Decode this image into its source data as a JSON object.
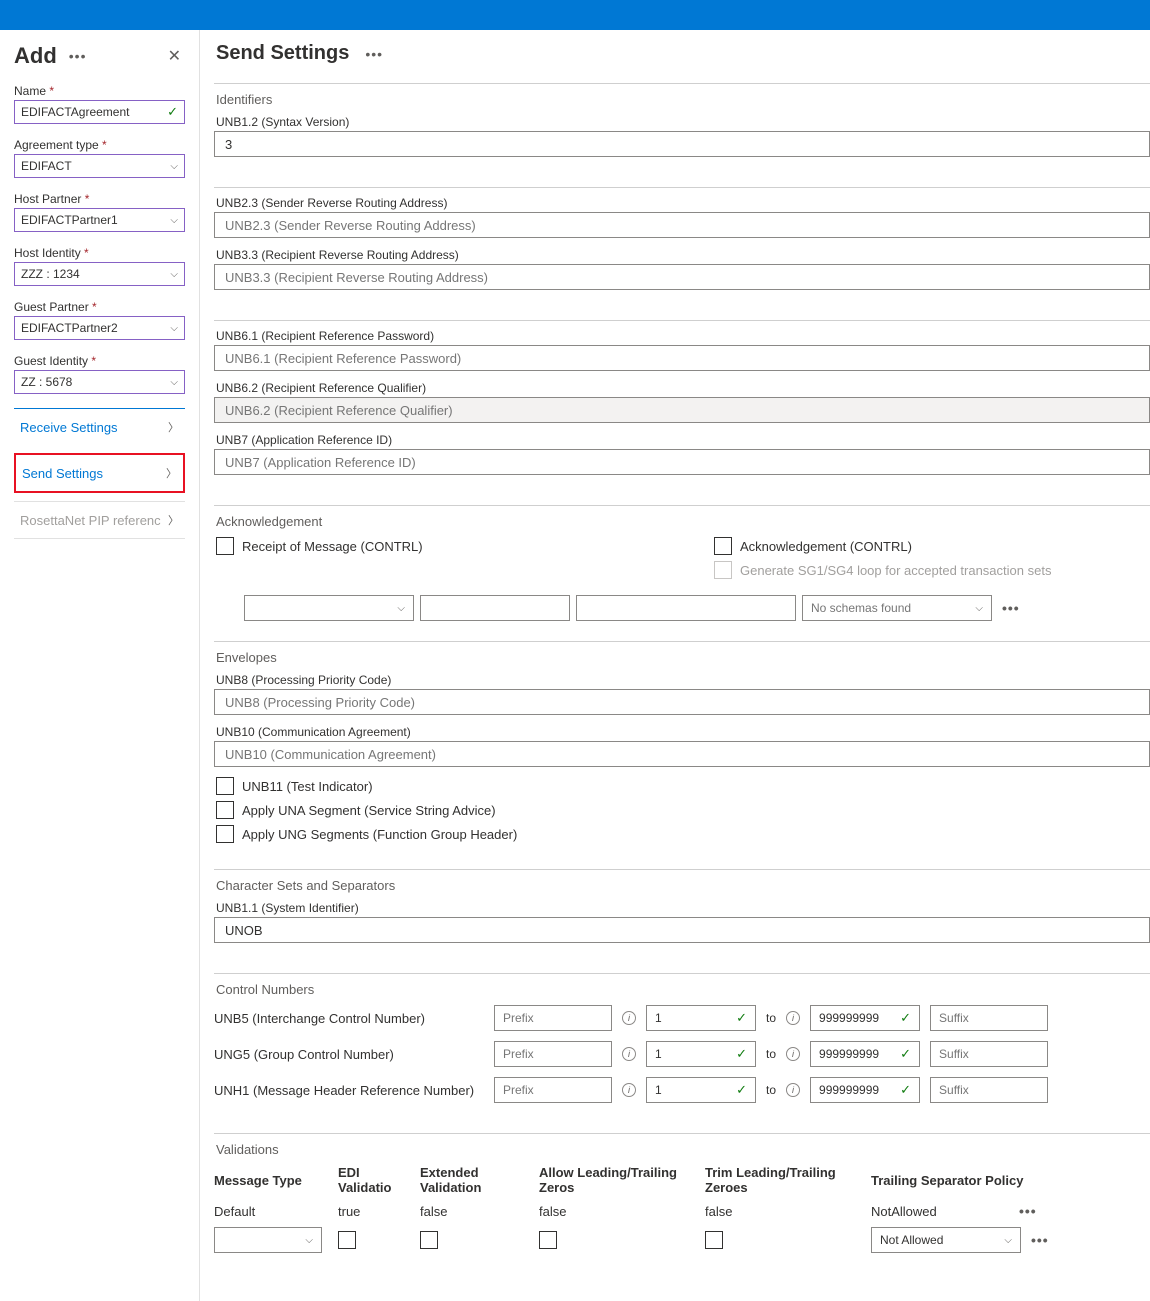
{
  "sidebar": {
    "title": "Add",
    "fields": {
      "name": {
        "label": "Name",
        "value": "EDIFACTAgreement"
      },
      "agreementType": {
        "label": "Agreement type",
        "value": "EDIFACT"
      },
      "hostPartner": {
        "label": "Host Partner",
        "value": "EDIFACTPartner1"
      },
      "hostIdentity": {
        "label": "Host Identity",
        "value": "ZZZ : 1234"
      },
      "guestPartner": {
        "label": "Guest Partner",
        "value": "EDIFACTPartner2"
      },
      "guestIdentity": {
        "label": "Guest Identity",
        "value": "ZZ : 5678"
      }
    },
    "nav": {
      "receive": "Receive Settings",
      "send": "Send Settings",
      "rosetta": "RosettaNet PIP referenc"
    }
  },
  "main": {
    "title": "Send Settings",
    "identifiers": {
      "section": "Identifiers",
      "unb12_label": "UNB1.2 (Syntax Version)",
      "unb12_value": "3",
      "unb23_label": "UNB2.3 (Sender Reverse Routing Address)",
      "unb23_placeholder": "UNB2.3 (Sender Reverse Routing Address)",
      "unb33_label": "UNB3.3 (Recipient Reverse Routing Address)",
      "unb33_placeholder": "UNB3.3 (Recipient Reverse Routing Address)",
      "unb61_label": "UNB6.1 (Recipient Reference Password)",
      "unb61_placeholder": "UNB6.1 (Recipient Reference Password)",
      "unb62_label": "UNB6.2 (Recipient Reference Qualifier)",
      "unb62_placeholder": "UNB6.2 (Recipient Reference Qualifier)",
      "unb7_label": "UNB7 (Application Reference ID)",
      "unb7_placeholder": "UNB7 (Application Reference ID)"
    },
    "ack": {
      "section": "Acknowledgement",
      "receipt": "Receipt of Message (CONTRL)",
      "ackContrl": "Acknowledgement (CONTRL)",
      "genLoop": "Generate SG1/SG4 loop for accepted transaction sets",
      "noSchemas": "No schemas found"
    },
    "envelopes": {
      "section": "Envelopes",
      "unb8_label": "UNB8 (Processing Priority Code)",
      "unb8_placeholder": "UNB8 (Processing Priority Code)",
      "unb10_label": "UNB10 (Communication Agreement)",
      "unb10_placeholder": "UNB10 (Communication Agreement)",
      "unb11": "UNB11 (Test Indicator)",
      "una": "Apply UNA Segment (Service String Advice)",
      "ung": "Apply UNG Segments (Function Group Header)"
    },
    "charset": {
      "section": "Character Sets and Separators",
      "unb11_label": "UNB1.1 (System Identifier)",
      "unb11_value": "UNOB"
    },
    "control": {
      "section": "Control Numbers",
      "to": "to",
      "prefix": "Prefix",
      "suffix": "Suffix",
      "rows": [
        {
          "label": "UNB5 (Interchange Control Number)",
          "from": "1",
          "toVal": "999999999"
        },
        {
          "label": "UNG5 (Group Control Number)",
          "from": "1",
          "toVal": "999999999"
        },
        {
          "label": "UNH1 (Message Header Reference Number)",
          "from": "1",
          "toVal": "999999999"
        }
      ]
    },
    "validations": {
      "section": "Validations",
      "headers": {
        "msgType": "Message Type",
        "edi": "EDI Validatio",
        "ext": "Extended Validation",
        "lead": "Allow Leading/Trailing Zeros",
        "trim": "Trim Leading/Trailing Zeroes",
        "trail": "Trailing Separator Policy"
      },
      "row1": {
        "msgType": "Default",
        "edi": "true",
        "ext": "false",
        "lead": "false",
        "trim": "false",
        "trail": "NotAllowed"
      },
      "row2": {
        "trailSel": "Not Allowed"
      }
    }
  }
}
